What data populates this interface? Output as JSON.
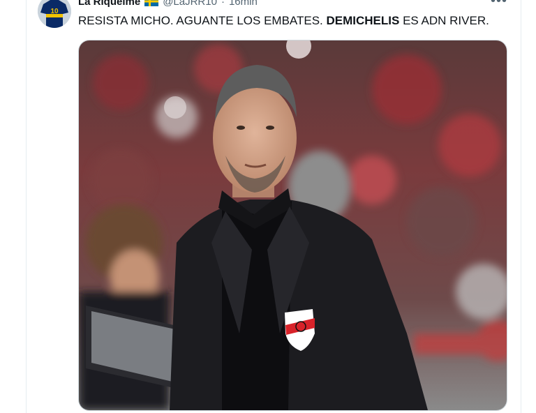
{
  "tweet": {
    "author_name": "La Riquelme",
    "author_handle": "@LaJRR10",
    "separator": "·",
    "time": "16min",
    "more_label": "•••",
    "text_prefix": "RESISTA MICHO. AGUANTE LOS EMBATES. ",
    "text_bold": "DEMICHELIS",
    "text_suffix": " ES ADN RIVER.",
    "avatar_number": "10"
  },
  "colors": {
    "flag_blue": "#006AA7",
    "flag_yellow": "#FECC00",
    "jersey_blue": "#0a2a66",
    "jersey_yellow": "#f2c200"
  }
}
